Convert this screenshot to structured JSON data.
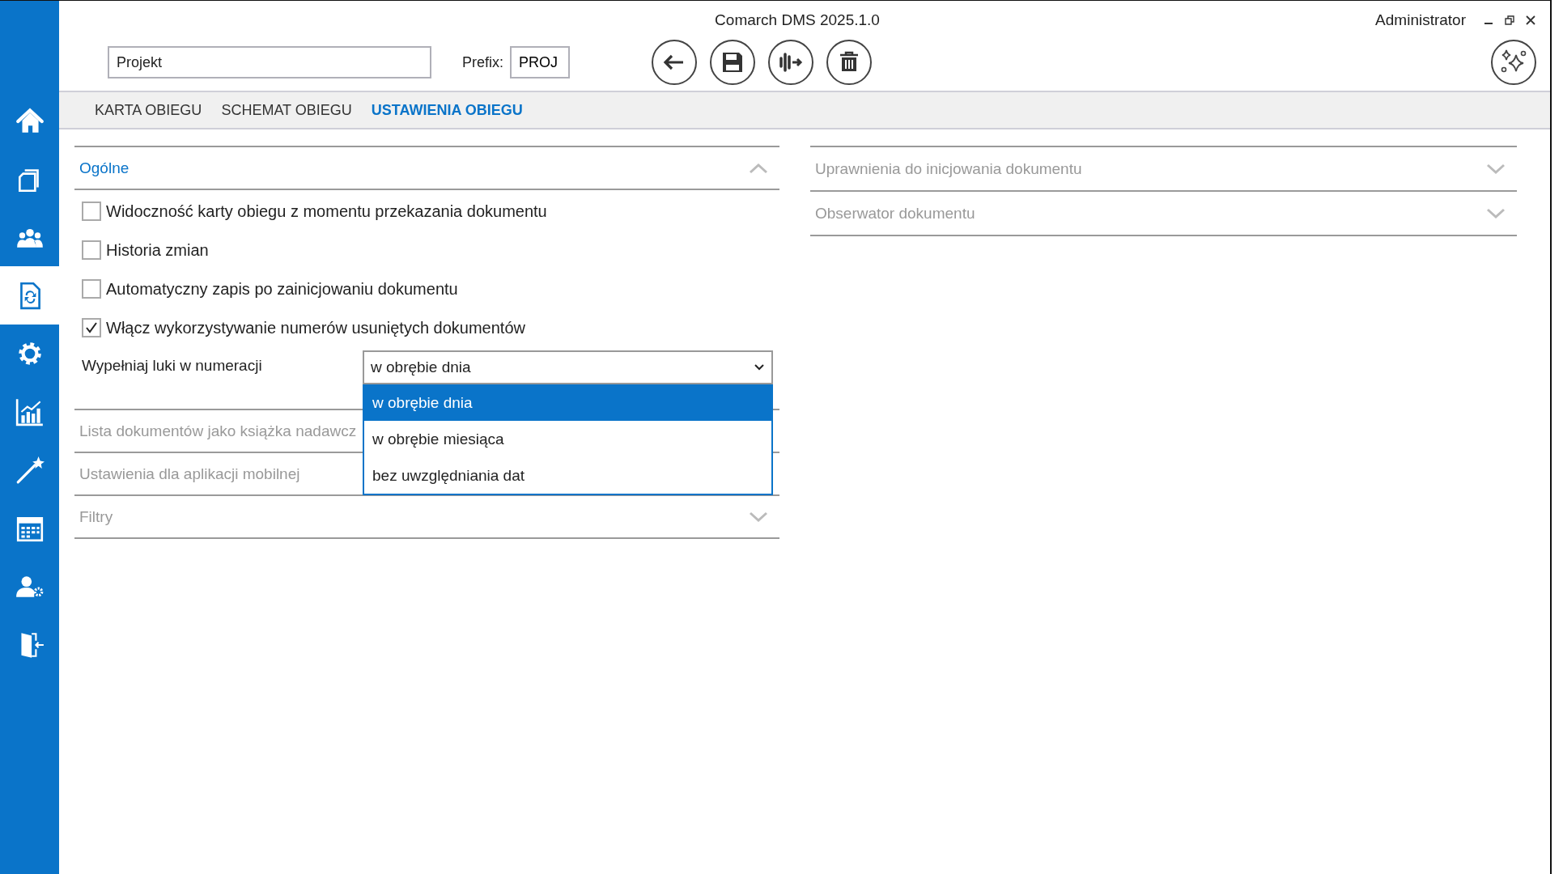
{
  "window": {
    "title": "Comarch DMS 2025.1.0",
    "user": "Administrator"
  },
  "sidebar": {
    "items": [
      {
        "selected": false
      },
      {
        "selected": false
      },
      {
        "selected": false
      },
      {
        "selected": true
      },
      {
        "selected": false
      },
      {
        "selected": false
      },
      {
        "selected": false
      },
      {
        "selected": false
      },
      {
        "selected": false
      },
      {
        "selected": false
      }
    ]
  },
  "header": {
    "name_field": {
      "value": "Projekt"
    },
    "prefix_label": "Prefix:",
    "prefix_field": {
      "value": "PROJ"
    }
  },
  "tabs": [
    {
      "label": "KARTA OBIEGU",
      "selected": false
    },
    {
      "label": "SCHEMAT OBIEGU",
      "selected": false
    },
    {
      "label": "USTAWIENIA OBIEGU",
      "selected": true
    }
  ],
  "left_sections": [
    {
      "title": "Ogólne",
      "expanded": true,
      "checkboxes": [
        {
          "label": "Widoczność karty obiegu z momentu przekazania dokumentu",
          "checked": false
        },
        {
          "label": "Historia zmian",
          "checked": false
        },
        {
          "label": "Automatyczny zapis po zainicjowaniu dokumentu",
          "checked": false
        },
        {
          "label": "Włącz wykorzystywanie numerów usuniętych dokumentów",
          "checked": true
        }
      ],
      "select": {
        "label": "Wypełniaj luki w numeracji",
        "value": "w obrębie dnia",
        "options": [
          {
            "label": "w obrębie dnia",
            "selected": true
          },
          {
            "label": "w obrębie miesiąca",
            "selected": false
          },
          {
            "label": "bez uwzględniania dat",
            "selected": false
          }
        ]
      }
    },
    {
      "title": "Lista dokumentów jako książka nadawcz"
    },
    {
      "title": "Ustawienia dla aplikacji mobilnej"
    },
    {
      "title": "Filtry",
      "expanded": false
    }
  ],
  "right_sections": [
    {
      "title": "Uprawnienia do inicjowania dokumentu",
      "expanded": false
    },
    {
      "title": "Obserwator dokumentu",
      "expanded": false
    }
  ]
}
